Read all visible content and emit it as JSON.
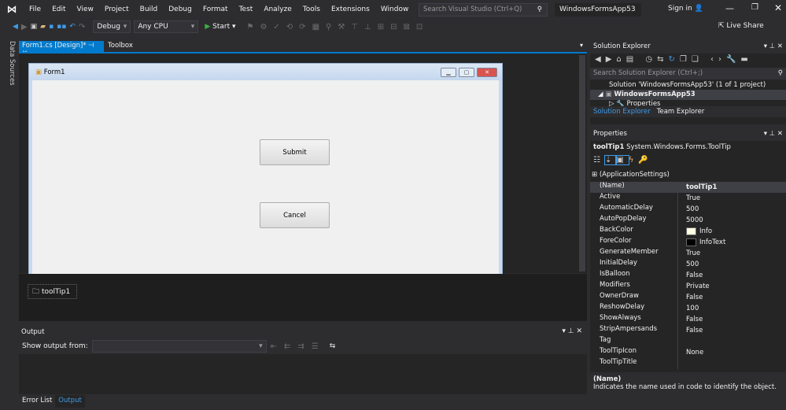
{
  "menu": {
    "items": [
      "File",
      "Edit",
      "View",
      "Project",
      "Build",
      "Debug",
      "Format",
      "Test",
      "Analyze",
      "Tools",
      "Extensions",
      "Window",
      "Help"
    ],
    "search_placeholder": "Search Visual Studio (Ctrl+Q)",
    "app_title": "WindowsFormsApp53",
    "sign_in": "Sign in"
  },
  "toolbar": {
    "config": "Debug",
    "platform": "Any CPU",
    "start": "Start",
    "live_share": "Live Share"
  },
  "left_strip": "Data Sources",
  "doc_tabs": [
    {
      "label": "Form1.cs [Design]*",
      "active": true
    },
    {
      "label": "Toolbox"
    }
  ],
  "form": {
    "title": "Form1",
    "buttons": [
      "Submit",
      "Cancel"
    ]
  },
  "tray": {
    "component": "toolTip1"
  },
  "output": {
    "title": "Output",
    "show_from": "Show output from:",
    "source": ""
  },
  "bottom_tabs": [
    "Error List",
    "Output"
  ],
  "solution_explorer": {
    "title": "Solution Explorer",
    "search_placeholder": "Search Solution Explorer (Ctrl+;)",
    "items": [
      "Solution 'WindowsFormsApp53' (1 of 1 project)",
      "WindowsFormsApp53",
      "Properties"
    ],
    "tabs": [
      "Solution Explorer",
      "Team Explorer"
    ]
  },
  "properties": {
    "title": "Properties",
    "object_name": "toolTip1",
    "object_type": "System.Windows.Forms.ToolTip",
    "group": "(ApplicationSettings)",
    "rows": [
      {
        "name": "(Name)",
        "value": "toolTip1"
      },
      {
        "name": "Active",
        "value": "True"
      },
      {
        "name": "AutomaticDelay",
        "value": "500"
      },
      {
        "name": "AutoPopDelay",
        "value": "5000"
      },
      {
        "name": "BackColor",
        "value": "Info",
        "swatch": "#ffffe1"
      },
      {
        "name": "ForeColor",
        "value": "InfoText",
        "swatch": "#000000"
      },
      {
        "name": "GenerateMember",
        "value": "True"
      },
      {
        "name": "InitialDelay",
        "value": "500"
      },
      {
        "name": "IsBalloon",
        "value": "False"
      },
      {
        "name": "Modifiers",
        "value": "Private"
      },
      {
        "name": "OwnerDraw",
        "value": "False"
      },
      {
        "name": "ReshowDelay",
        "value": "100"
      },
      {
        "name": "ShowAlways",
        "value": "False"
      },
      {
        "name": "StripAmpersands",
        "value": "False"
      },
      {
        "name": "Tag",
        "value": ""
      },
      {
        "name": "ToolTipIcon",
        "value": "None"
      },
      {
        "name": "ToolTipTitle",
        "value": ""
      }
    ],
    "desc_title": "(Name)",
    "desc_text": "Indicates the name used in code to identify the object."
  },
  "colors": {
    "accent": "#007acc",
    "bg": "#2d2d30"
  }
}
